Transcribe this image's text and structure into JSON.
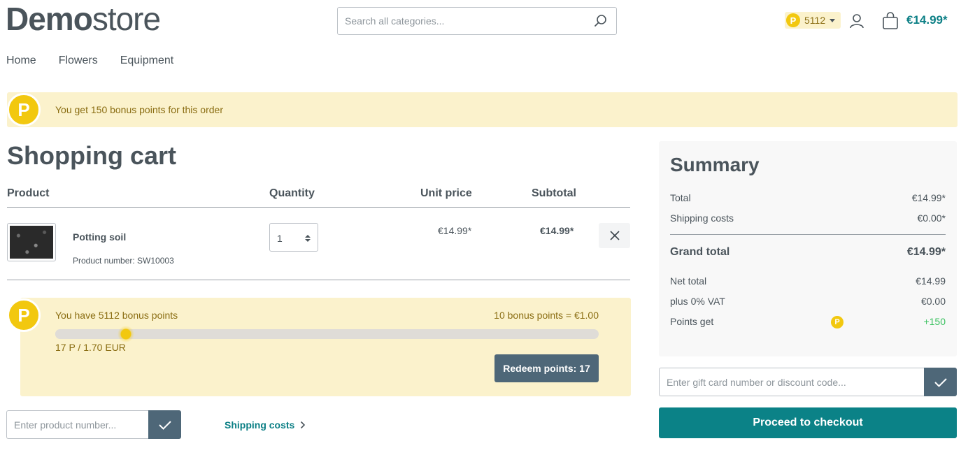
{
  "header": {
    "logo_bold": "Demo",
    "logo_light": "store",
    "search_placeholder": "Search all categories...",
    "points_badge": "5112",
    "cart_total": "€14.99*"
  },
  "nav": [
    "Home",
    "Flowers",
    "Equipment"
  ],
  "banner": {
    "coin_letter": "P",
    "text": "You get 150 bonus points for this order"
  },
  "cart": {
    "title": "Shopping cart",
    "columns": {
      "product": "Product",
      "quantity": "Quantity",
      "unit_price": "Unit price",
      "subtotal": "Subtotal"
    },
    "items": [
      {
        "name": "Potting soil",
        "product_number": "Product number: SW10003",
        "quantity": "1",
        "unit_price": "€14.99*",
        "subtotal": "€14.99*"
      }
    ]
  },
  "redeem": {
    "coin_letter": "P",
    "have_text": "You have 5112 bonus points",
    "rate_text": "10 bonus points = €1.00",
    "slider_value_text": "17 P / 1.70 EUR",
    "slider_fraction": 0.13,
    "button_label": "Redeem points: 17"
  },
  "product_number_input": {
    "placeholder": "Enter product number..."
  },
  "shipping_link": "Shipping costs",
  "summary": {
    "title": "Summary",
    "total_label": "Total",
    "total_value": "€14.99*",
    "shipping_label": "Shipping costs",
    "shipping_value": "€0.00*",
    "grand_label": "Grand total",
    "grand_value": "€14.99*",
    "net_label": "Net total",
    "net_value": "€14.99",
    "vat_label": "plus 0% VAT",
    "vat_value": "€0.00",
    "points_label": "Points get",
    "points_coin": "P",
    "points_value": "+150"
  },
  "gift_input": {
    "placeholder": "Enter gift card number or discount code..."
  },
  "checkout_label": "Proceed to checkout",
  "colors": {
    "accent": "#0b8287",
    "button_dark": "#4e6778",
    "points_yellow": "#f2c80f",
    "banner_bg": "#fbf2cc",
    "positive_green": "#3cc261"
  }
}
